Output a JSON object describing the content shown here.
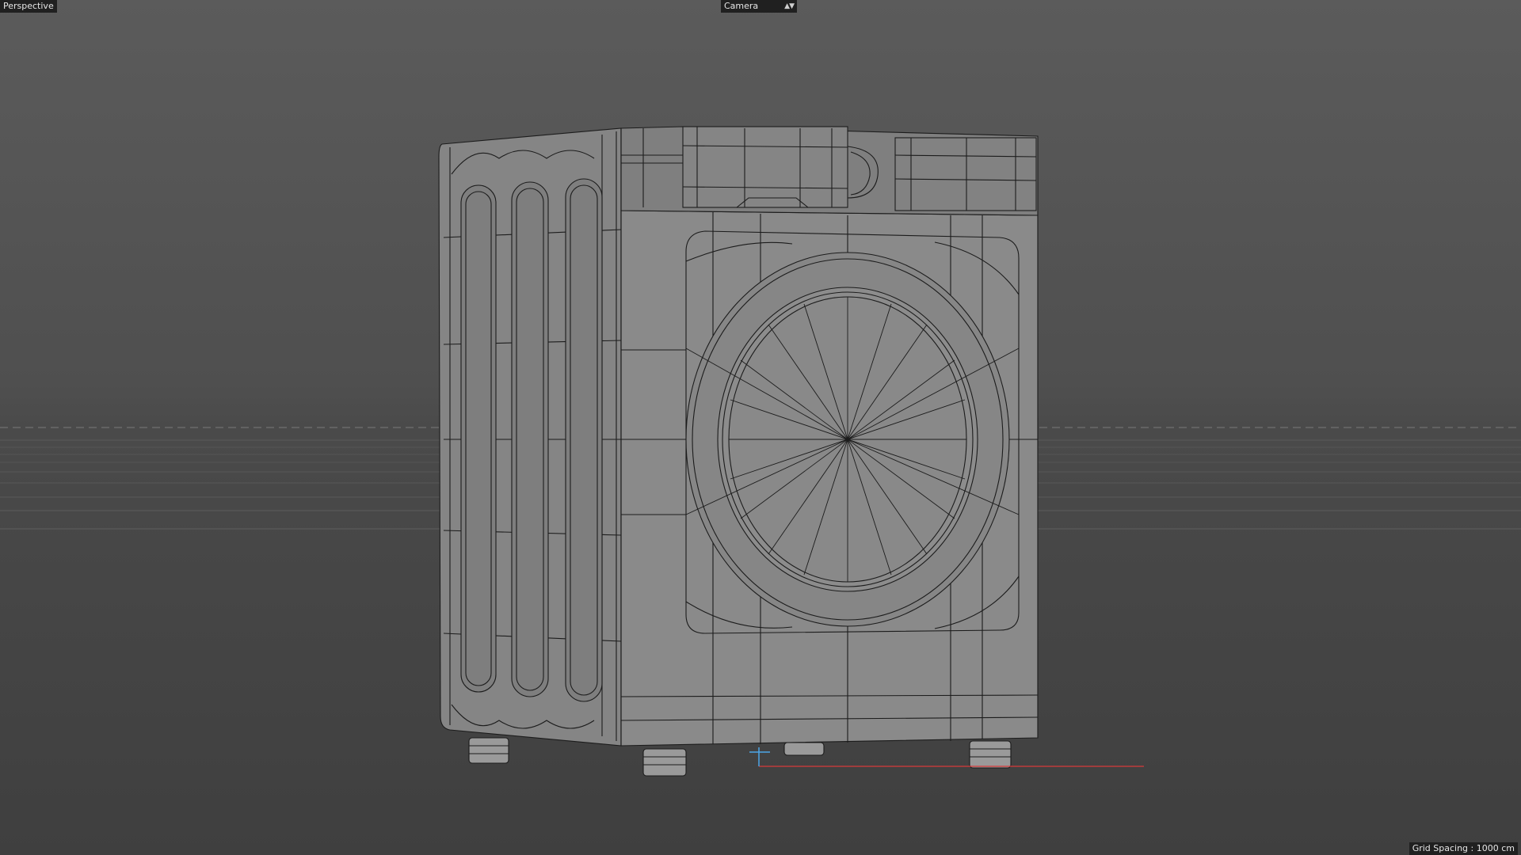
{
  "viewport": {
    "view_name": "Perspective",
    "camera_label": "Camera",
    "grid_spacing_text": "Grid Spacing : 1000 cm"
  },
  "colors": {
    "background_top": "#5b5b5b",
    "background_bottom": "#3f3f3f",
    "mesh_fill": "#888888",
    "wireframe": "#1c1c1c",
    "axis_x": "#d83a3a",
    "axis_y": "#4da6e8",
    "label_background": "#202020"
  },
  "icons": {
    "camera_dropdown": "updown-arrows-icon"
  }
}
